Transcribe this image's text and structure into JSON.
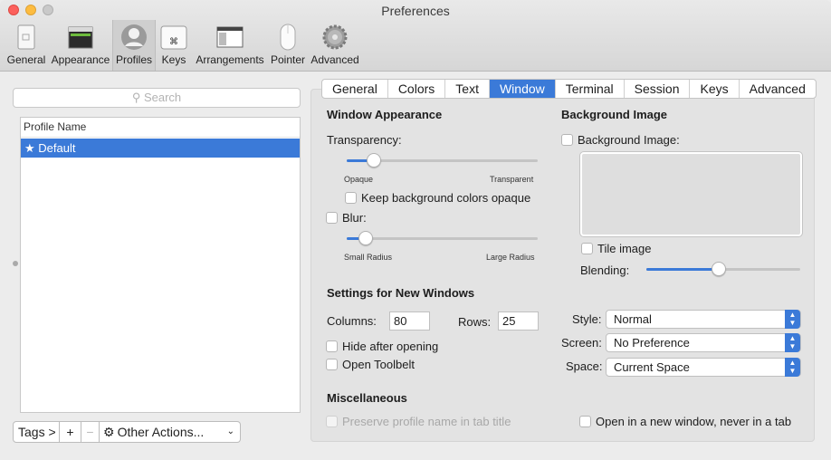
{
  "window": {
    "title": "Preferences"
  },
  "toolbar": {
    "items": [
      {
        "label": "General",
        "icon": "general-icon"
      },
      {
        "label": "Appearance",
        "icon": "appearance-icon"
      },
      {
        "label": "Profiles",
        "icon": "profiles-icon",
        "selected": true
      },
      {
        "label": "Keys",
        "icon": "keys-icon"
      },
      {
        "label": "Arrangements",
        "icon": "arrangements-icon"
      },
      {
        "label": "Pointer",
        "icon": "pointer-icon"
      },
      {
        "label": "Advanced",
        "icon": "gear-icon"
      }
    ]
  },
  "sidebar": {
    "search_placeholder": "Search",
    "column_header": "Profile Name",
    "profiles": [
      {
        "name": "★ Default",
        "selected": true
      }
    ],
    "tags_label": "Tags >",
    "add_label": "+",
    "remove_label": "−",
    "other_actions_label": "Other Actions..."
  },
  "tabs": [
    "General",
    "Colors",
    "Text",
    "Window",
    "Terminal",
    "Session",
    "Keys",
    "Advanced"
  ],
  "active_tab": "Window",
  "window_appearance": {
    "heading": "Window Appearance",
    "transparency_label": "Transparency:",
    "transparency_value": 0.14,
    "opaque_label": "Opaque",
    "transparent_label": "Transparent",
    "keep_bg_opaque_label": "Keep background colors opaque",
    "keep_bg_opaque_checked": false,
    "blur_label": "Blur:",
    "blur_checked": false,
    "blur_value": 0.1,
    "small_radius_label": "Small Radius",
    "large_radius_label": "Large Radius"
  },
  "background_image": {
    "heading": "Background Image",
    "bg_image_label": "Background Image:",
    "bg_image_checked": false,
    "tile_label": "Tile image",
    "tile_checked": false,
    "blending_label": "Blending:",
    "blending_value": 0.47
  },
  "new_windows": {
    "heading": "Settings for New Windows",
    "columns_label": "Columns:",
    "columns_value": "80",
    "rows_label": "Rows:",
    "rows_value": "25",
    "hide_after_opening_label": "Hide after opening",
    "open_toolbelt_label": "Open Toolbelt",
    "style_label": "Style:",
    "style_value": "Normal",
    "screen_label": "Screen:",
    "screen_value": "No Preference",
    "space_label": "Space:",
    "space_value": "Current Space"
  },
  "misc": {
    "heading": "Miscellaneous",
    "preserve_name_label": "Preserve profile name in tab title",
    "open_new_window_label": "Open in a new window, never in a tab"
  },
  "colors": {
    "accent": "#3b7ad8"
  }
}
